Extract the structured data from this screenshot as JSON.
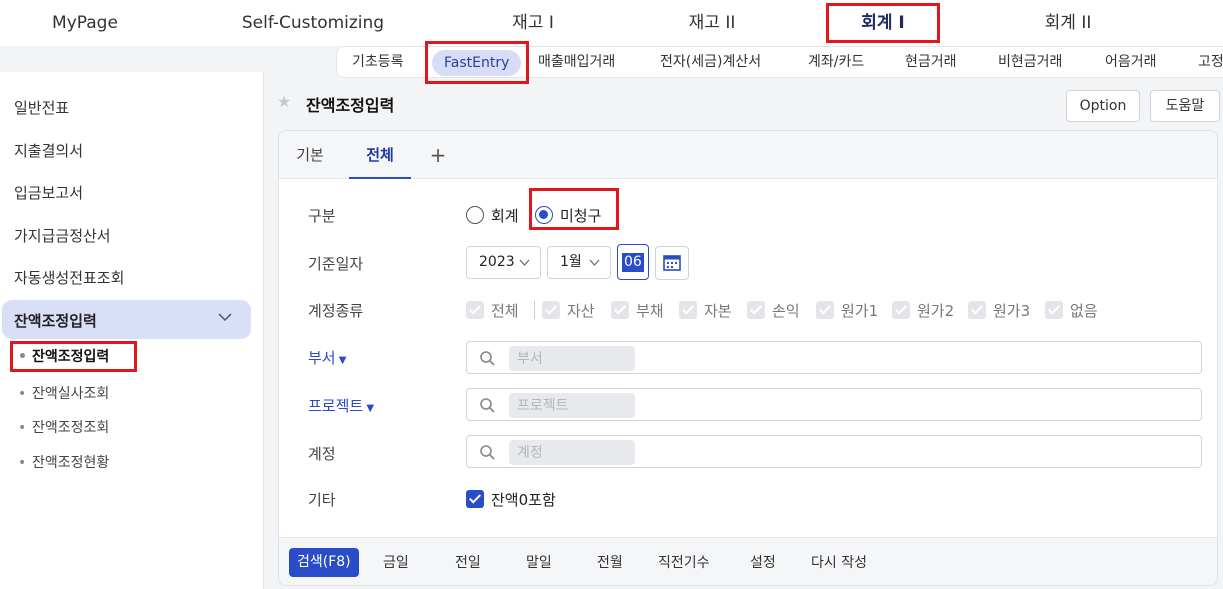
{
  "top_nav": [
    {
      "label": "MyPage"
    },
    {
      "label": "Self-Customizing"
    },
    {
      "label": "재고 I"
    },
    {
      "label": "재고 II"
    },
    {
      "label": "회계 I",
      "active": true
    },
    {
      "label": "회계 II"
    }
  ],
  "sub_nav": [
    {
      "label": "기초등록"
    },
    {
      "label": "FastEntry",
      "active": true
    },
    {
      "label": "매출매입거래"
    },
    {
      "label": "전자(세금)계산서"
    },
    {
      "label": "계좌/카드"
    },
    {
      "label": "현금거래"
    },
    {
      "label": "비현금거래"
    },
    {
      "label": "어음거래"
    },
    {
      "label": "고정"
    }
  ],
  "sidebar": {
    "items": [
      {
        "label": "일반전표"
      },
      {
        "label": "지출결의서"
      },
      {
        "label": "입금보고서"
      },
      {
        "label": "가지급금정산서"
      },
      {
        "label": "자동생성전표조회"
      }
    ],
    "active_group": {
      "label": "잔액조정입력"
    },
    "sub_items": [
      {
        "label": "잔액조정입력",
        "current": true
      },
      {
        "label": "잔액실사조회"
      },
      {
        "label": "잔액조정조회"
      },
      {
        "label": "잔액조정현황"
      }
    ]
  },
  "page": {
    "title": "잔액조정입력",
    "option_label": "Option",
    "help_label": "도움말"
  },
  "tabs": [
    {
      "label": "기본"
    },
    {
      "label": "전체",
      "active": true
    },
    {
      "label": "+"
    }
  ],
  "form": {
    "category": {
      "label": "구분",
      "options": [
        {
          "label": "회계",
          "selected": false
        },
        {
          "label": "미청구",
          "selected": true
        }
      ]
    },
    "date": {
      "label": "기준일자",
      "year": "2023",
      "month": "1월",
      "day": "06"
    },
    "account_type": {
      "label": "계정종류",
      "options": [
        "전체",
        "자산",
        "부채",
        "자본",
        "손익",
        "원가1",
        "원가2",
        "원가3",
        "없음"
      ]
    },
    "department": {
      "label": "부서",
      "placeholder": "부서"
    },
    "project": {
      "label": "프로젝트",
      "placeholder": "프로젝트"
    },
    "account": {
      "label": "계정",
      "placeholder": "계정"
    },
    "etc": {
      "label": "기타",
      "checkbox_label": "잔액0포함",
      "checked": true
    }
  },
  "bottom_buttons": [
    {
      "label": "검색(F8)",
      "primary": true
    },
    {
      "label": "금일"
    },
    {
      "label": "전일"
    },
    {
      "label": "말일"
    },
    {
      "label": "전월"
    },
    {
      "label": "직전기수"
    },
    {
      "label": "설정"
    },
    {
      "label": "다시 작성"
    }
  ],
  "colors": {
    "accent": "#2a4cc8",
    "highlight_box": "#e1171e",
    "active_pill": "#d7ddf6"
  }
}
